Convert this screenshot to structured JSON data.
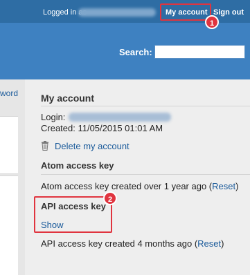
{
  "topbar": {
    "logged_in_label": "Logged in as",
    "my_account_label": "My account",
    "sign_out_label": "Sign out"
  },
  "header": {
    "search_label": "Search:",
    "search_value": ""
  },
  "sidebar": {
    "link_fragment": "word"
  },
  "account": {
    "title": "My account",
    "login_label": "Login:",
    "created_label": "Created: 11/05/2015 01:01 AM",
    "delete_label": "Delete my account"
  },
  "atom": {
    "heading": "Atom access key",
    "text": "Atom access key created over 1 year ago (",
    "reset_label": "Reset",
    "close_paren": ")"
  },
  "api": {
    "heading": "API access key",
    "show_label": "Show",
    "text": "API access key created 4 months ago (",
    "reset_label": "Reset",
    "close_paren": ")"
  },
  "annotations": {
    "badge1": "1",
    "badge2": "2",
    "color": "#e0343f"
  },
  "colors": {
    "topbar": "#2e6da4",
    "header": "#3e81c1",
    "link": "#1a5a9a"
  }
}
